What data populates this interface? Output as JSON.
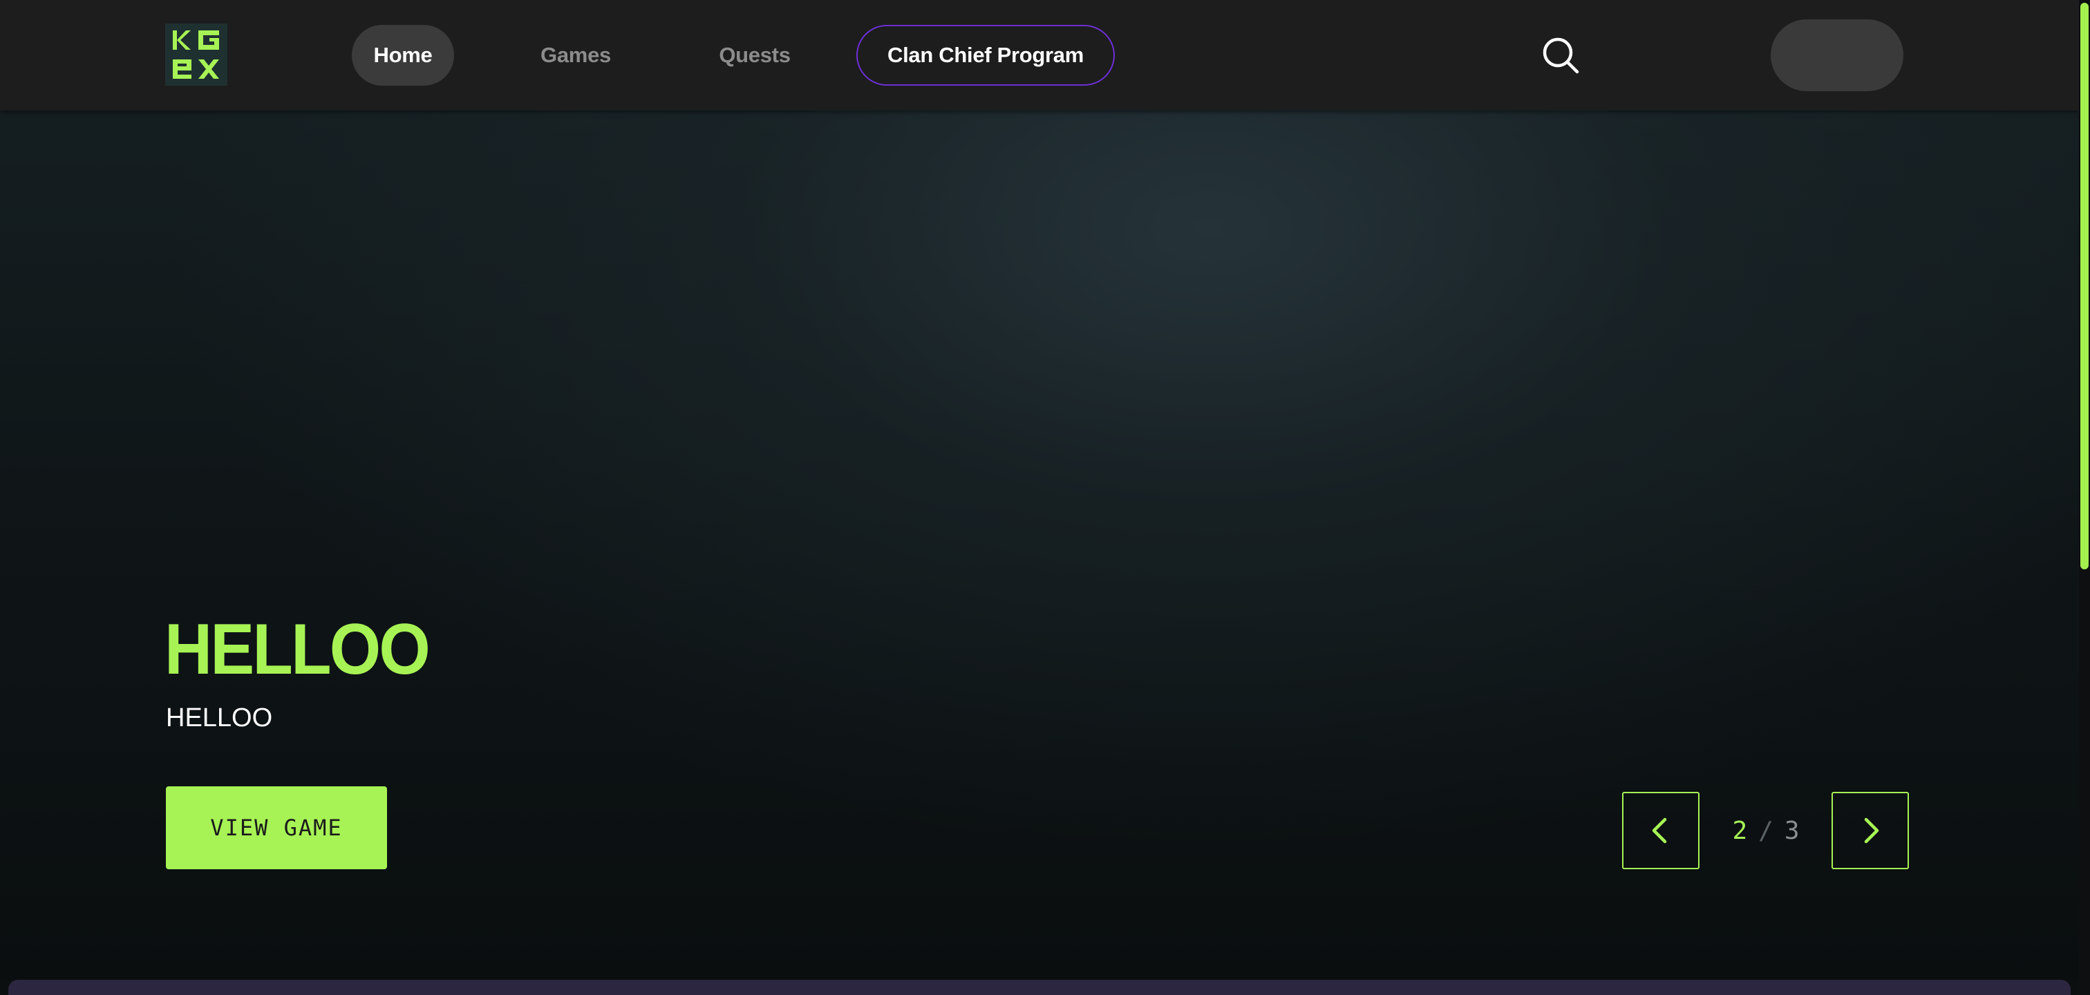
{
  "nav": {
    "logo_icon": "kgen-logo-icon",
    "items": [
      {
        "label": "Home",
        "active": true
      },
      {
        "label": "Games",
        "active": false
      },
      {
        "label": "Quests",
        "active": false
      },
      {
        "label": "Clan Chief Program",
        "active": false
      }
    ],
    "search_icon": "search-icon"
  },
  "hero": {
    "title": "HELLOO",
    "subtitle": "HELLOO",
    "cta_label": "VIEW GAME"
  },
  "carousel": {
    "current": "2",
    "separator": "/",
    "total": "3",
    "prev_icon": "chevron-left-icon",
    "next_icon": "chevron-right-icon"
  },
  "colors": {
    "accent": "#a7f355",
    "nav_background": "#1d1d1d",
    "clan_border": "#6d2fd6",
    "active_pill": "#3b3b3b"
  }
}
